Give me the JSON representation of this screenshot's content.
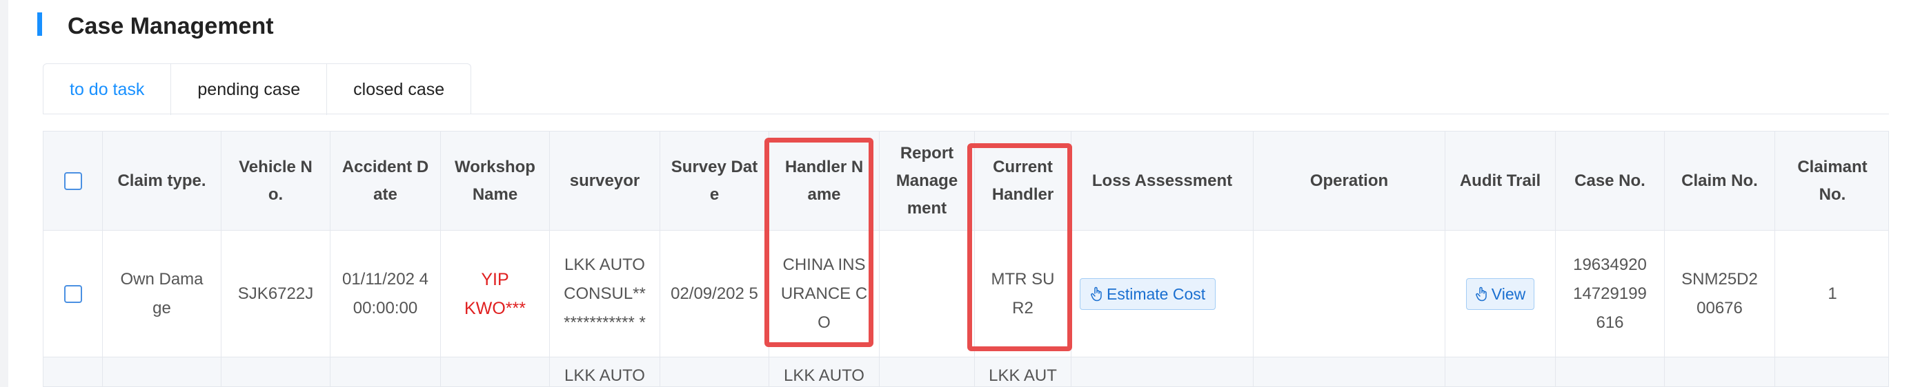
{
  "page": {
    "title": "Case Management"
  },
  "tabs": [
    {
      "label": "to do task",
      "active": true
    },
    {
      "label": "pending case",
      "active": false
    },
    {
      "label": "closed case",
      "active": false
    }
  ],
  "table": {
    "headers": {
      "claim_type": "Claim type.",
      "vehicle_no": "Vehicle N o.",
      "accident_date": "Accident D ate",
      "workshop_name": "Workshop Name",
      "surveyor": "surveyor",
      "survey_date": "Survey Dat e",
      "handler_name": "Handler N ame",
      "report_management": "Report Manage ment",
      "current_handler": "Current Handler",
      "loss_assessment": "Loss Assessment",
      "operation": "Operation",
      "audit_trail": "Audit Trail",
      "case_no": "Case No.",
      "claim_no": "Claim No.",
      "claimant_no": "Claimant No."
    },
    "rows": [
      {
        "claim_type": "Own Dama ge",
        "vehicle_no": "SJK6722J",
        "accident_date": "01/11/202 4 00:00:00",
        "workshop_name": "YIP KWO***",
        "surveyor": "LKK AUTO CONSUL** *********** *",
        "survey_date": "02/09/202 5",
        "handler_name": "CHINA INS URANCE C O",
        "report_management": "",
        "current_handler": "MTR SU R2",
        "loss_assessment_button": "Estimate Cost",
        "operation": "",
        "audit_trail_button": "View",
        "case_no": "19634920 14729199 616",
        "claim_no": "SNM25D2 00676",
        "claimant_no": "1"
      },
      {
        "surveyor": "LKK AUTO",
        "handler_name": "LKK AUTO",
        "current_handler": "LKK AUT"
      }
    ]
  },
  "colors": {
    "accent": "#1890ff",
    "highlight": "#e84d4d",
    "workshop_text": "#e02020"
  }
}
